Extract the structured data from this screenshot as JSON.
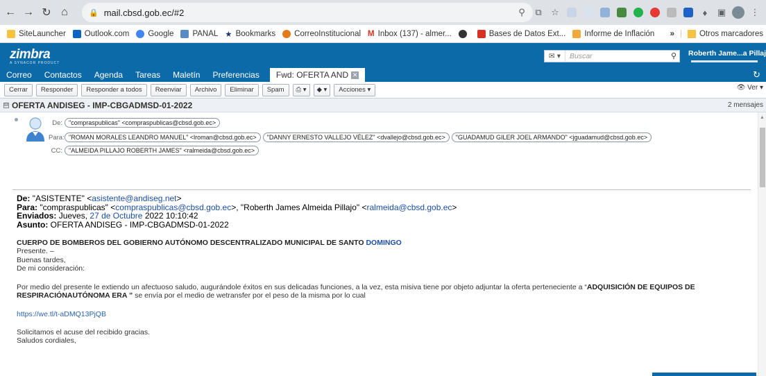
{
  "browser": {
    "url": "mail.cbsd.gob.ec/#2",
    "bookmarks": [
      {
        "label": "SiteLauncher",
        "color": "#f5c242"
      },
      {
        "label": "Outlook.com",
        "color": "#0a64c2"
      },
      {
        "label": "Google",
        "color": "#4285f4"
      },
      {
        "label": "PANAL",
        "color": "#5a8ac4"
      },
      {
        "label": "Bookmarks",
        "color": "#1e3a6d"
      },
      {
        "label": "CorreoInstitucional",
        "color": "#e57a1b"
      },
      {
        "label": "Inbox (137) - almer...",
        "color": "#d93025"
      },
      {
        "label": "",
        "color": "#333333"
      },
      {
        "label": "Bases de Datos Ext...",
        "color": "#d93025"
      },
      {
        "label": "Informe de Inflación",
        "color": "#f2a93b"
      }
    ],
    "other_bookmarks": "Otros marcadores",
    "more": "»"
  },
  "zimbra": {
    "logo": "zimbra",
    "logo_sub": "A SYNACOR PRODUCT",
    "search_placeholder": "Buscar",
    "user": "Roberth Jame...a Pillajo",
    "tabs": [
      "Correo",
      "Contactos",
      "Agenda",
      "Tareas",
      "Maletín",
      "Preferencias"
    ],
    "active_tab": "Fwd: OFERTA AND",
    "toolbar": {
      "cerrar": "Cerrar",
      "responder": "Responder",
      "responder_todos": "Responder a todos",
      "reenviar": "Reenviar",
      "archivo": "Archivo",
      "eliminar": "Eliminar",
      "spam": "Spam",
      "acciones": "Acciones",
      "ver": "Ver"
    },
    "conversation_subject": "OFERTA ANDISEG - IMP-CBGADMSD-01-2022",
    "message_count": "2 mensajes"
  },
  "message": {
    "de_label": "De:",
    "para_label": "Para:",
    "cc_label": "CC:",
    "from": "\"compraspublicas\" <compraspublicas@cbsd.gob.ec>",
    "to": [
      "\"ROMAN MORALES LEANDRO MANUEL\" <lroman@cbsd.gob.ec>",
      "\"DANNY ERNESTO VALLEJO VÉLEZ\" <dvallejo@cbsd.gob.ec>",
      "\"GUADAMUD GILER JOEL ARMANDO\" <jguadamud@cbsd.gob.ec>"
    ],
    "cc": "\"ALMEIDA PILLAJO ROBERTH JAMES\" <ralmeida@cbsd.gob.ec>"
  },
  "forwarded": {
    "de_label": "De:",
    "de_name": "\"ASISTENTE\" <",
    "de_email": "asistente@andiseg.net",
    "de_end": ">",
    "para_label": "Para:",
    "para_1": "\"compraspublicas\" <",
    "para_1_email": "compraspublicas@cbsd.gob.ec",
    "para_2": ">, \"Roberth James Almeida Pillajo\" <",
    "para_2_email": "ralmeida@cbsd.gob.ec",
    "para_end": ">",
    "enviados_label": "Enviados:",
    "enviados_day": "Jueves,",
    "enviados_date": "27 de Octubre",
    "enviados_time": "2022 10:10:42",
    "asunto_label": "Asunto:",
    "asunto": "OFERTA ANDISEG - IMP-CBGADMSD-01-2022",
    "org": "CUERPO DE BOMBEROS DEL GOBIERNO AUTÓNOMO DESCENTRALIZADO MUNICIPAL DE SANTO",
    "org_end": "DOMINGO",
    "presente": "Presente. –",
    "saludo": "Buenas tardes,",
    "consideracion": "De mi consideración:",
    "body_1": "Por medio del presente le extiendo un afectuoso saludo, augurándole éxitos en sus delicadas funciones, a la vez, esta misiva tiene por objeto adjuntar la oferta perteneciente a “",
    "body_bold_1": "ADQUISICIÓN DE EQUIPOS DE",
    "body_bold_2": "RESPIRACIÓNAUTÓNOMA ERA ”",
    "body_2": "se envía por el medio de wetransfer por el peso de la misma por lo cual",
    "link": "https://we.tl/t-aDMQ13PjQB",
    "acuse": "Solicitamos el acuse del recibido gracias.",
    "cordiales": "Saludos cordiales,"
  }
}
